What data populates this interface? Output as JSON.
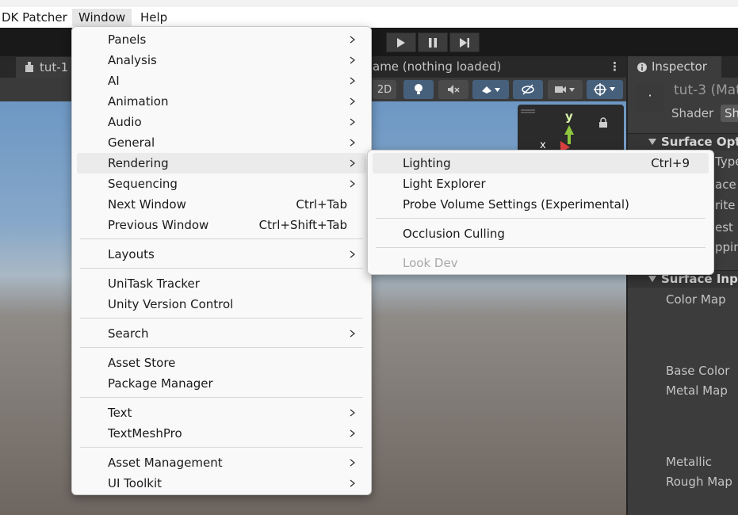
{
  "menubar": {
    "items": [
      "DK Patcher",
      "Window",
      "Help"
    ]
  },
  "scene": {
    "tab_label": "tut-1",
    "game_title": "ame (nothing loaded)",
    "btn_2d": "2D",
    "gizmo_axis_y": "y",
    "gizmo_axis_x": "x"
  },
  "inspector": {
    "tab_label": "Inspector",
    "material_name": "tut-3 (Mat",
    "shader_label": "Shader",
    "shader_value": "Sh",
    "surface_options": "Surface Optic",
    "opt_type": "Type",
    "opt_face": "ace",
    "opt_write": "rite",
    "opt_test": "est",
    "opt_clipping": "ppin",
    "surface_inputs": "Surface Input",
    "color_map": "Color Map",
    "base_color": "Base Color",
    "metal_map": "Metal Map",
    "metallic": "Metallic",
    "rough_map": "Rough Map"
  },
  "window_menu": {
    "items": [
      {
        "label": "Panels",
        "shortcut": "",
        "submenu": true
      },
      {
        "label": "Analysis",
        "shortcut": "",
        "submenu": true
      },
      {
        "label": "AI",
        "shortcut": "",
        "submenu": true
      },
      {
        "label": "Animation",
        "shortcut": "",
        "submenu": true
      },
      {
        "label": "Audio",
        "shortcut": "",
        "submenu": true
      },
      {
        "label": "General",
        "shortcut": "",
        "submenu": true
      },
      {
        "label": "Rendering",
        "shortcut": "",
        "submenu": true
      },
      {
        "label": "Sequencing",
        "shortcut": "",
        "submenu": true
      },
      {
        "label": "Next Window",
        "shortcut": "Ctrl+Tab",
        "submenu": false
      },
      {
        "label": "Previous Window",
        "shortcut": "Ctrl+Shift+Tab",
        "submenu": false
      },
      {
        "label": "Layouts",
        "shortcut": "",
        "submenu": true
      },
      {
        "label": "UniTask Tracker",
        "shortcut": "",
        "submenu": false
      },
      {
        "label": "Unity Version Control",
        "shortcut": "",
        "submenu": false
      },
      {
        "label": "Search",
        "shortcut": "",
        "submenu": true
      },
      {
        "label": "Asset Store",
        "shortcut": "",
        "submenu": false
      },
      {
        "label": "Package Manager",
        "shortcut": "",
        "submenu": false
      },
      {
        "label": "Text",
        "shortcut": "",
        "submenu": true
      },
      {
        "label": "TextMeshPro",
        "shortcut": "",
        "submenu": true
      },
      {
        "label": "Asset Management",
        "shortcut": "",
        "submenu": true
      },
      {
        "label": "UI Toolkit",
        "shortcut": "",
        "submenu": true
      }
    ]
  },
  "rendering_submenu": {
    "items": [
      {
        "label": "Lighting",
        "shortcut": "Ctrl+9"
      },
      {
        "label": "Light Explorer",
        "shortcut": ""
      },
      {
        "label": "Probe Volume Settings (Experimental)",
        "shortcut": ""
      },
      {
        "label": "Occlusion Culling",
        "shortcut": ""
      },
      {
        "label": "Look Dev",
        "shortcut": "",
        "disabled": true
      }
    ]
  }
}
